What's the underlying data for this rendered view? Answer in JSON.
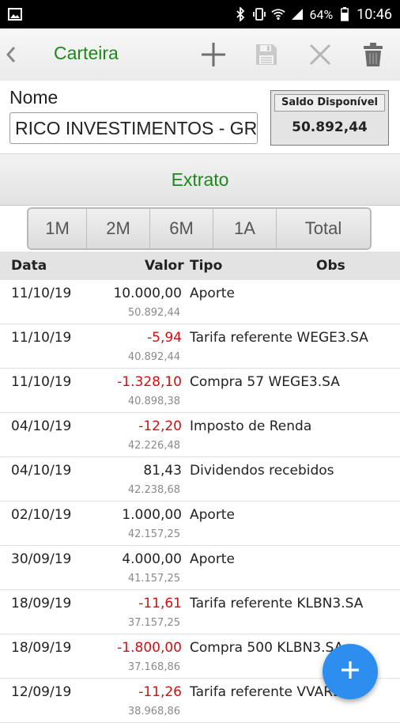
{
  "status_bar": {
    "battery": "64%",
    "time": "10:46",
    "icons": [
      "image-icon",
      "bluetooth-icon",
      "vibrate-icon",
      "wifi-icon",
      "signal-icon",
      "battery-icon"
    ]
  },
  "appbar": {
    "title": "Carteira",
    "actions": [
      "back-icon",
      "add-icon",
      "save-icon",
      "close-icon",
      "delete-icon"
    ],
    "accent": "#1b8a1b"
  },
  "form": {
    "nome_label": "Nome",
    "nome_value": "RICO INVESTIMENTOS - GR",
    "saldo_label": "Saldo Disponível",
    "saldo_value": "50.892,44"
  },
  "extrato_label": "Extrato",
  "periods": [
    "1M",
    "2M",
    "6M",
    "1A",
    "Total"
  ],
  "table": {
    "headers": {
      "data": "Data",
      "valor": "Valor",
      "tipo": "Tipo",
      "obs": "Obs"
    },
    "rows": [
      {
        "date": "11/10/19",
        "value": "10.000,00",
        "type": "Aporte",
        "balance": "50.892,44",
        "negative": false
      },
      {
        "date": "11/10/19",
        "value": "-5,94",
        "type": "Tarifa referente WEGE3.SA",
        "balance": "40.892,44",
        "negative": true
      },
      {
        "date": "11/10/19",
        "value": "-1.328,10",
        "type": "Compra 57 WEGE3.SA",
        "balance": "40.898,38",
        "negative": true
      },
      {
        "date": "04/10/19",
        "value": "-12,20",
        "type": "Imposto de Renda",
        "balance": "42.226,48",
        "negative": true
      },
      {
        "date": "04/10/19",
        "value": "81,43",
        "type": "Dividendos recebidos",
        "balance": "42.238,68",
        "negative": false
      },
      {
        "date": "02/10/19",
        "value": "1.000,00",
        "type": "Aporte",
        "balance": "42.157,25",
        "negative": false
      },
      {
        "date": "30/09/19",
        "value": "4.000,00",
        "type": "Aporte",
        "balance": "41.157,25",
        "negative": false
      },
      {
        "date": "18/09/19",
        "value": "-11,61",
        "type": "Tarifa referente KLBN3.SA",
        "balance": "37.157,25",
        "negative": true
      },
      {
        "date": "18/09/19",
        "value": "-1.800,00",
        "type": "Compra 500 KLBN3.SA",
        "balance": "37.168,86",
        "negative": true
      },
      {
        "date": "12/09/19",
        "value": "-11,26",
        "type": "Tarifa referente VVAR3.SA",
        "balance": "38.968,86",
        "negative": true
      }
    ]
  },
  "fab_icon": "plus-icon",
  "colors": {
    "negative": "#d01010",
    "fab": "#2d8ef0",
    "header_bg": "#e3e3e3"
  }
}
